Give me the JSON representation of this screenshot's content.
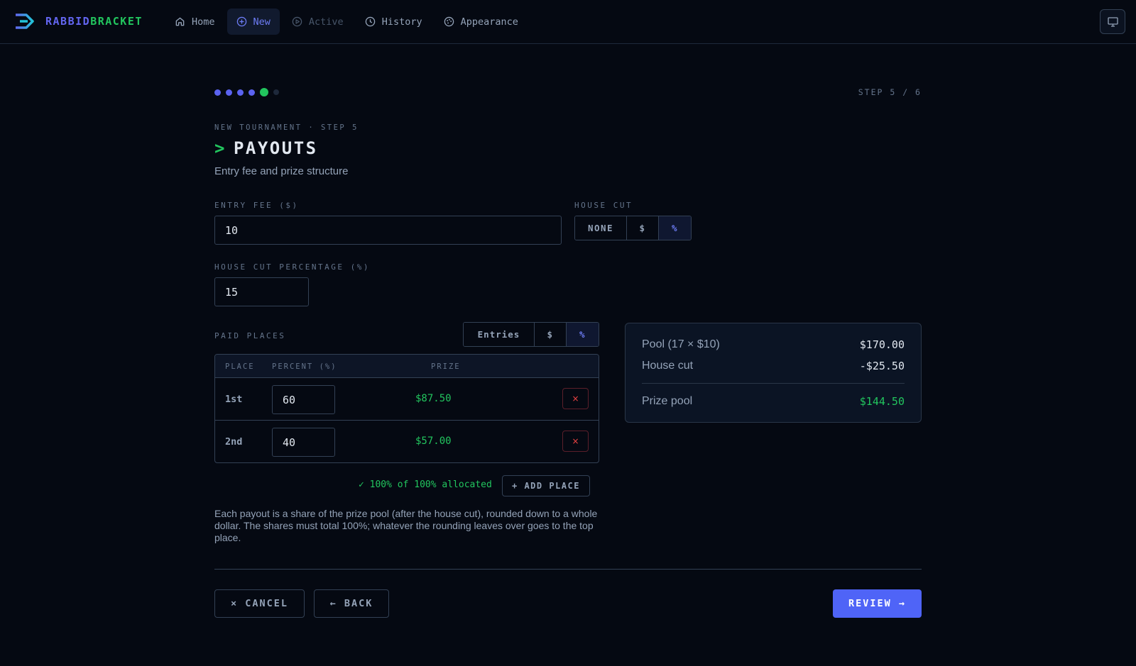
{
  "brand": {
    "part1": "RABBID",
    "part2": "BRACKET"
  },
  "nav": {
    "home": "Home",
    "new": "New",
    "active": "Active",
    "history": "History",
    "appearance": "Appearance"
  },
  "icons": {
    "logo": "logo-arrow-icon",
    "home": "home-icon",
    "new": "plus-circle-icon",
    "active": "play-circle-icon",
    "history": "clock-icon",
    "appearance": "palette-icon",
    "theme": "monitor-icon",
    "remove": "close-icon"
  },
  "progress": {
    "total": 6,
    "current": 5
  },
  "step_counter": "STEP 5 / 6",
  "eyebrow": "NEW TOURNAMENT · STEP 5",
  "title": {
    "prompt": ">",
    "text": "PAYOUTS"
  },
  "subtitle": "Entry fee and prize structure",
  "entry_fee": {
    "label": "ENTRY FEE ($)",
    "value": "10"
  },
  "house_cut": {
    "label": "HOUSE CUT",
    "options": [
      "NONE",
      "$",
      "%"
    ],
    "selected": "%"
  },
  "house_cut_pct": {
    "label": "HOUSE CUT PERCENTAGE (%)",
    "value": "15"
  },
  "paid_places": {
    "label": "PAID PLACES",
    "modes": [
      "Entries",
      "$",
      "%"
    ],
    "selected": "%",
    "columns": [
      "PLACE",
      "PERCENT (%)",
      "PRIZE"
    ],
    "rows": [
      {
        "place": "1st",
        "percent": "60",
        "prize": "$87.50",
        "remove": "×"
      },
      {
        "place": "2nd",
        "percent": "40",
        "prize": "$57.00",
        "remove": "×"
      }
    ],
    "allocated": "✓ 100% of 100% allocated",
    "add_label": "+ ADD PLACE"
  },
  "help_text": "Each payout is a share of the prize pool (after the house cut), rounded down to a whole dollar. The shares must total 100%; whatever the rounding leaves over goes to the top place.",
  "summary": {
    "pool_label": "Pool (17 × $10)",
    "pool_value": "$170.00",
    "cut_label": "House cut",
    "cut_value": "-$25.50",
    "prize_label": "Prize pool",
    "prize_value": "$144.50"
  },
  "buttons": {
    "cancel": "× CANCEL",
    "back": "← BACK",
    "review": "REVIEW →"
  },
  "colors": {
    "background": "#050912",
    "accent": "#4f64f7",
    "success": "#22c55e",
    "danger": "#ef4444"
  }
}
